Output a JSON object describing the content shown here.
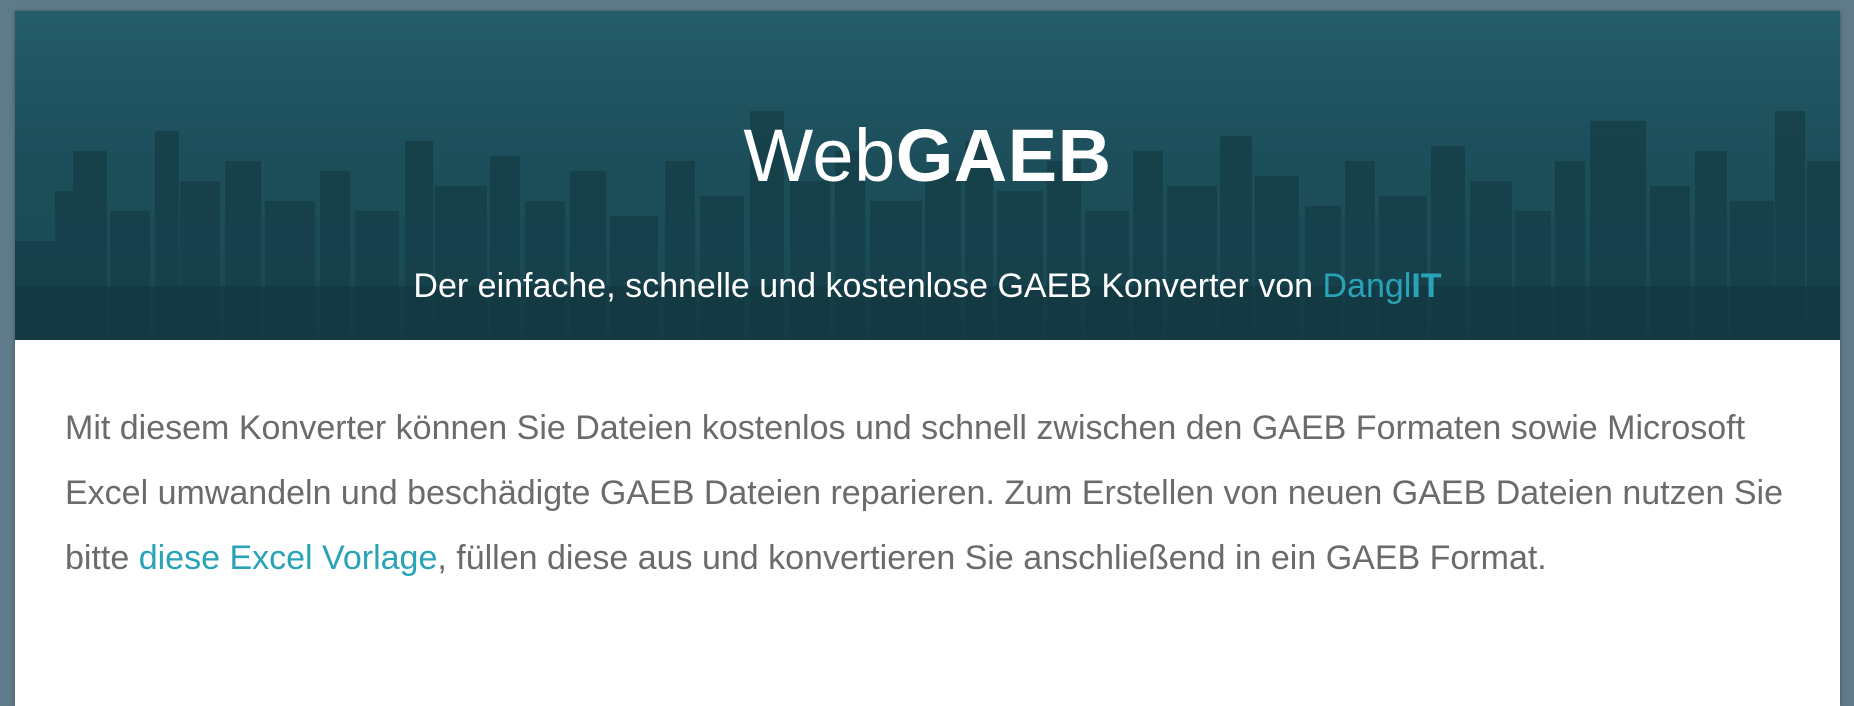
{
  "hero": {
    "title_light": "Web",
    "title_bold": "GAEB",
    "subtitle_prefix": "Der einfache, schnelle und kostenlose GAEB Konverter von ",
    "brand_light": "Dangl",
    "brand_bold": "IT"
  },
  "intro": {
    "text_before_link": "Mit diesem Konverter können Sie Dateien kostenlos und schnell zwischen den GAEB Formaten sowie Microsoft Excel umwandeln und beschädigte GAEB Dateien reparieren. Zum Erstellen von neuen GAEB Dateien nutzen Sie bitte ",
    "link_label": "diese Excel Vorlage",
    "text_after_link": ", füllen diese aus und konvertieren Sie anschließend in ein GAEB Format."
  },
  "colors": {
    "hero_background": "#1c4f5b",
    "accent": "#2aa3b8",
    "body_text": "#6b6b6b",
    "page_background": "#5f7b8a"
  }
}
